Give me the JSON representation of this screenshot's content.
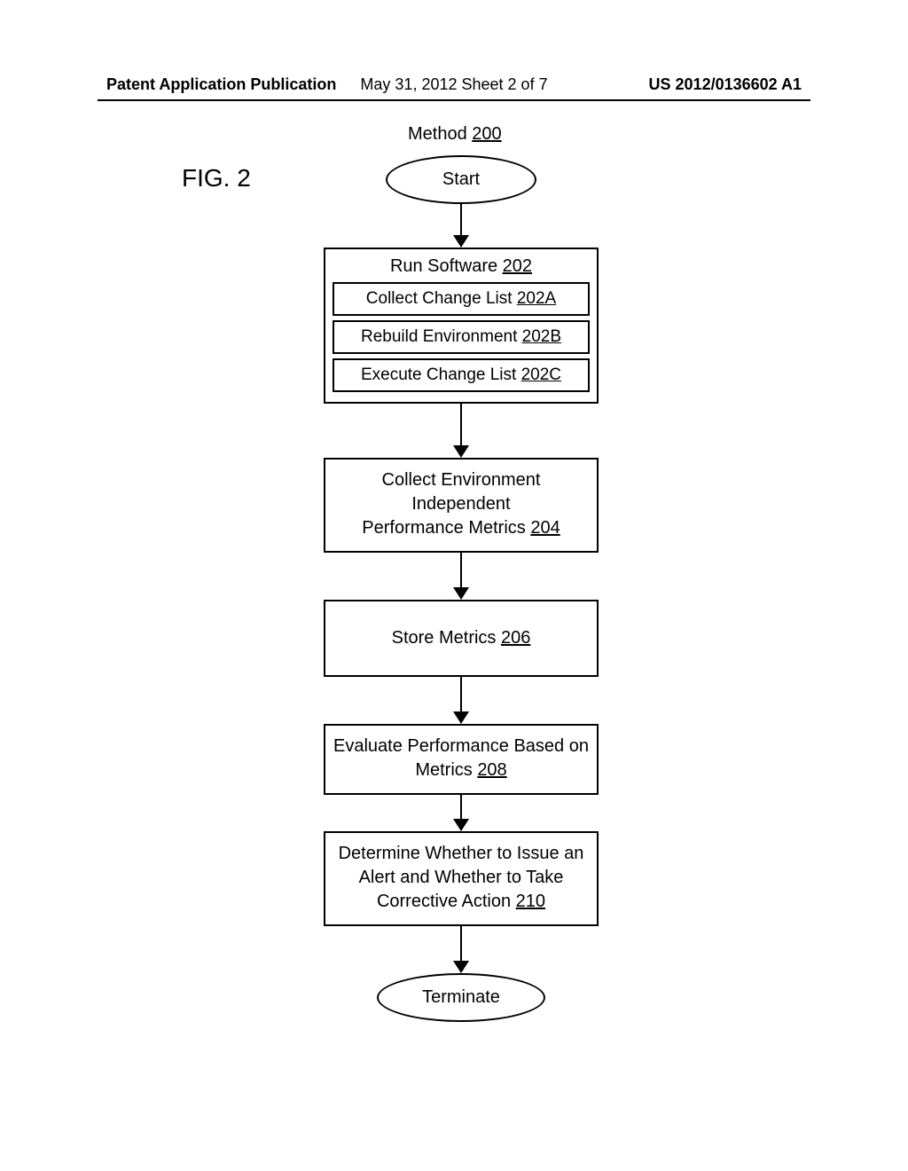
{
  "header": {
    "left": "Patent Application Publication",
    "center_prefix": "May 31, 2012  Sheet ",
    "center_current": "2",
    "center_of": " of ",
    "center_total": "7",
    "right": "US 2012/0136602 A1"
  },
  "labels": {
    "method_prefix": "Method ",
    "method_ref": "200",
    "fig": "FIG. 2"
  },
  "flow": {
    "start": "Start",
    "terminate": "Terminate",
    "box202": {
      "title_prefix": "Run Software ",
      "title_ref": "202",
      "a_prefix": "Collect Change List ",
      "a_ref": "202A",
      "b_prefix": "Rebuild Environment ",
      "b_ref": "202B",
      "c_prefix": "Execute Change List ",
      "c_ref": "202C"
    },
    "box204": {
      "line1": "Collect Environment Independent",
      "line2_prefix": "Performance Metrics ",
      "line2_ref": "204"
    },
    "box206": {
      "prefix": "Store Metrics ",
      "ref": "206"
    },
    "box208": {
      "line1": "Evaluate Performance Based on",
      "line2_prefix": "Metrics ",
      "line2_ref": "208"
    },
    "box210": {
      "line1": "Determine Whether to Issue an",
      "line2": "Alert and Whether to Take",
      "line3_prefix": "Corrective Action ",
      "line3_ref": "210"
    }
  }
}
